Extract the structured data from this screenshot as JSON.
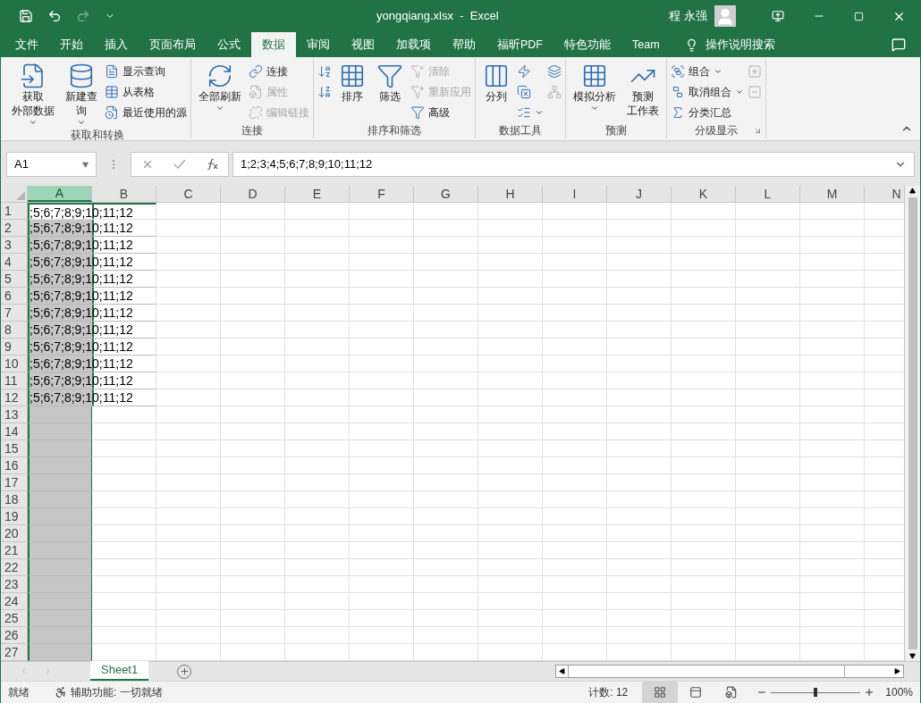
{
  "title_bar": {
    "title": "yongqiang.xlsx  -  Excel",
    "user": "程 永强"
  },
  "menu_tabs": [
    {
      "label": "文件",
      "selected": false
    },
    {
      "label": "开始",
      "selected": false
    },
    {
      "label": "插入",
      "selected": false
    },
    {
      "label": "页面布局",
      "selected": false
    },
    {
      "label": "公式",
      "selected": false
    },
    {
      "label": "数据",
      "selected": true
    },
    {
      "label": "审阅",
      "selected": false
    },
    {
      "label": "视图",
      "selected": false
    },
    {
      "label": "加载项",
      "selected": false
    },
    {
      "label": "帮助",
      "selected": false
    },
    {
      "label": "福昕PDF",
      "selected": false
    },
    {
      "label": "特色功能",
      "selected": false
    },
    {
      "label": "Team",
      "selected": false
    }
  ],
  "tell_me": "操作说明搜索",
  "ribbon": {
    "groups": [
      {
        "label": "获取和转换",
        "columns": [
          {
            "kind": "large",
            "lines": [
              "获取",
              "外部数据"
            ],
            "menu": true,
            "disabled": false
          },
          {
            "kind": "large",
            "lines": [
              "新建查",
              "询"
            ],
            "menu": true,
            "disabled": false
          },
          {
            "kind": "stack",
            "items": [
              {
                "label": "显示查询",
                "disabled": false
              },
              {
                "label": "从表格",
                "disabled": false
              },
              {
                "label": "最近使用的源",
                "disabled": false
              }
            ]
          }
        ]
      },
      {
        "label": "连接",
        "columns": [
          {
            "kind": "large",
            "lines": [
              "全部刷新"
            ],
            "menu": true,
            "disabled": false
          },
          {
            "kind": "stack",
            "items": [
              {
                "label": "连接",
                "disabled": false
              },
              {
                "label": "属性",
                "disabled": true
              },
              {
                "label": "编辑链接",
                "disabled": true
              }
            ]
          }
        ]
      },
      {
        "label": "排序和筛选",
        "columns": [
          {
            "kind": "stack",
            "items": [
              {
                "disabled": false
              },
              {
                "disabled": false
              }
            ]
          },
          {
            "kind": "large",
            "lines": [
              "排序"
            ],
            "menu": false,
            "disabled": false
          },
          {
            "kind": "large",
            "lines": [
              "筛选"
            ],
            "menu": false,
            "disabled": false
          },
          {
            "kind": "stack",
            "items": [
              {
                "label": "清除",
                "disabled": true
              },
              {
                "label": "重新应用",
                "disabled": true
              },
              {
                "label": "高级",
                "disabled": false
              }
            ]
          }
        ]
      },
      {
        "label": "数据工具",
        "columns": [
          {
            "kind": "large",
            "lines": [
              "分列"
            ],
            "menu": false,
            "disabled": false
          },
          {
            "kind": "stack",
            "items": [
              {
                "disabled": false
              },
              {
                "disabled": false
              },
              {
                "disabled": false,
                "menu": true
              }
            ]
          },
          {
            "kind": "stack",
            "items": [
              {
                "disabled": false
              },
              {
                "disabled": true
              }
            ]
          }
        ]
      },
      {
        "label": "预测",
        "columns": [
          {
            "kind": "large",
            "lines": [
              "模拟分析"
            ],
            "menu": true,
            "disabled": false
          },
          {
            "kind": "large",
            "lines": [
              "预测",
              "工作表"
            ],
            "menu": false,
            "disabled": false
          }
        ]
      },
      {
        "label": "分级显示",
        "launcher": true,
        "columns": [
          {
            "kind": "stack",
            "items": [
              {
                "label": "组合",
                "menu": true,
                "disabled": false
              },
              {
                "label": "取消组合",
                "menu": true,
                "disabled": false
              },
              {
                "label": "分类汇总",
                "disabled": false
              }
            ]
          },
          {
            "kind": "stack",
            "items": [
              {
                "disabled": true
              },
              {
                "disabled": true
              }
            ]
          }
        ]
      }
    ]
  },
  "formula_bar": {
    "name_box": "A1",
    "formula": "1;2;3;4;5;6;7;8;9;10;11;12"
  },
  "columns": [
    {
      "label": "A",
      "selected": true
    },
    {
      "label": "B",
      "selected": false
    },
    {
      "label": "C",
      "selected": false
    },
    {
      "label": "D",
      "selected": false
    },
    {
      "label": "E",
      "selected": false
    },
    {
      "label": "F",
      "selected": false
    },
    {
      "label": "G",
      "selected": false
    },
    {
      "label": "H",
      "selected": false
    },
    {
      "label": "I",
      "selected": false
    },
    {
      "label": "J",
      "selected": false
    },
    {
      "label": "K",
      "selected": false
    },
    {
      "label": "L",
      "selected": false
    },
    {
      "label": "M",
      "selected": false
    },
    {
      "label": "N",
      "selected": false
    }
  ],
  "rows": [
    {
      "number": "1",
      "text": ";5;6;7;8;9;10;11;12"
    },
    {
      "number": "2",
      "text": ";5;6;7;8;9;10;11;12"
    },
    {
      "number": "3",
      "text": ";5;6;7;8;9;10;11;12"
    },
    {
      "number": "4",
      "text": ";5;6;7;8;9;10;11;12"
    },
    {
      "number": "5",
      "text": ";5;6;7;8;9;10;11;12"
    },
    {
      "number": "6",
      "text": ";5;6;7;8;9;10;11;12"
    },
    {
      "number": "7",
      "text": ";5;6;7;8;9;10;11;12"
    },
    {
      "number": "8",
      "text": ";5;6;7;8;9;10;11;12"
    },
    {
      "number": "9",
      "text": ";5;6;7;8;9;10;11;12"
    },
    {
      "number": "10",
      "text": ";5;6;7;8;9;10;11;12"
    },
    {
      "number": "11",
      "text": ";5;6;7;8;9;10;11;12"
    },
    {
      "number": "12",
      "text": ";5;6;7;8;9;10;11;12"
    },
    {
      "number": "13"
    },
    {
      "number": "14"
    },
    {
      "number": "15"
    },
    {
      "number": "16"
    },
    {
      "number": "17"
    },
    {
      "number": "18"
    },
    {
      "number": "19"
    },
    {
      "number": "20"
    },
    {
      "number": "21"
    },
    {
      "number": "22"
    },
    {
      "number": "23"
    },
    {
      "number": "24"
    },
    {
      "number": "25"
    },
    {
      "number": "26"
    },
    {
      "number": "27"
    }
  ],
  "sheet_tabs": [
    {
      "label": "Sheet1",
      "selected": true
    }
  ],
  "status_bar": {
    "mode": "就绪",
    "accessibility": "辅助功能: 一切就绪",
    "count": "计数: 12",
    "view_buttons": [
      {
        "kind": "normal",
        "selected": true
      },
      {
        "kind": "page_layout",
        "selected": false
      },
      {
        "kind": "page_break",
        "selected": false
      }
    ],
    "zoom": "100%",
    "zoom_slider": {
      "level": 0.5
    }
  }
}
